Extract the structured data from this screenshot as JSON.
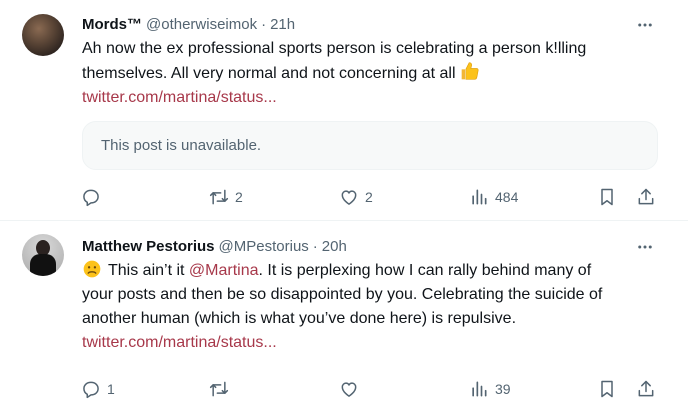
{
  "tweets": [
    {
      "display_name": "Mords™",
      "handle": "@otherwiseimok",
      "separator": "·",
      "time": "21h",
      "text_line1": "Ah now the ex professional sports person is celebrating a person k!lling",
      "text_line2": "themselves. All very normal and not concerning at all",
      "link": "twitter.com/martina/status...",
      "quote": "This post is unavailable.",
      "reply_count": "",
      "retweet_count": "2",
      "like_count": "2",
      "view_count": "484"
    },
    {
      "display_name": "Matthew Pestorius",
      "handle": "@MPestorius",
      "separator": "·",
      "time": "20h",
      "text_part1": "This ain’t it ",
      "mention": "@Martina",
      "text_part2": ".  It is perplexing how I can rally behind many of",
      "text_line2": "your posts and then be so disappointed by you. Celebrating the suicide of",
      "text_line3": "another human (which is what you’ve done here) is repulsive.",
      "link": "twitter.com/martina/status...",
      "reply_count": "1",
      "retweet_count": "",
      "like_count": "",
      "view_count": "39"
    }
  ],
  "icons": {
    "more": "more-horizontal-icon",
    "reply": "reply-icon",
    "retweet": "retweet-icon",
    "like": "heart-icon",
    "views": "views-icon",
    "bookmark": "bookmark-icon",
    "share": "share-icon"
  },
  "colors": {
    "link": "#a7384a",
    "secondary_text": "#536471",
    "primary_text": "#0f1419"
  }
}
